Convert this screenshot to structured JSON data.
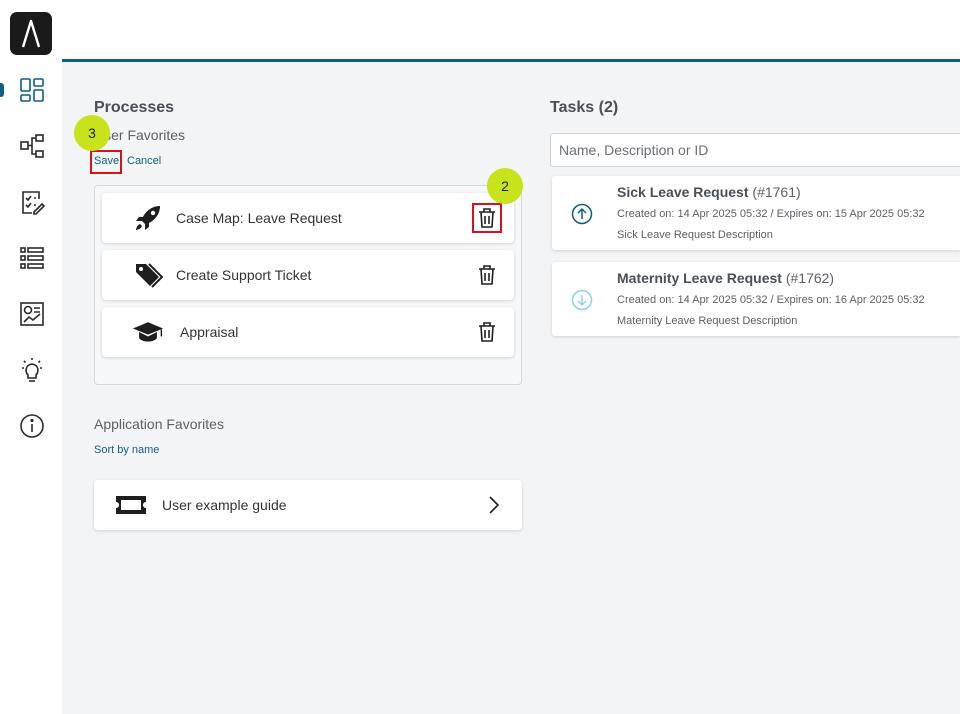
{
  "sidebar": {
    "items": [
      {
        "icon": "dashboard-icon",
        "active": true
      },
      {
        "icon": "process-map-icon"
      },
      {
        "icon": "task-checklist-icon"
      },
      {
        "icon": "list-icon"
      },
      {
        "icon": "report-chart-icon"
      },
      {
        "icon": "lightbulb-icon"
      },
      {
        "icon": "info-icon"
      }
    ]
  },
  "processes": {
    "title": "Processes",
    "user_favorites_label": "User Favorites",
    "save_label": "Save",
    "cancel_label": "Cancel",
    "favorites": [
      {
        "label": "Case Map: Leave Request",
        "icon": "rocket-icon"
      },
      {
        "label": "Create Support Ticket",
        "icon": "tags-icon"
      },
      {
        "label": "Appraisal",
        "icon": "graduation-cap-icon"
      }
    ],
    "application_favorites_label": "Application Favorites",
    "sort_label": "Sort by name",
    "app_favorites": [
      {
        "label": "User example guide",
        "icon": "ticket-icon"
      }
    ]
  },
  "annotations": {
    "badge_2": "2",
    "badge_3": "3"
  },
  "tasks": {
    "title": "Tasks (2)",
    "search_placeholder": "Name, Description or ID",
    "items": [
      {
        "name": "Sick Leave Request",
        "id": "(#1761)",
        "dates": "Created on: 14 Apr 2025 05:32 / Expires on: 15 Apr 2025 05:32",
        "description": "Sick Leave Request Description",
        "icon": "arrow-up-circle-icon"
      },
      {
        "name": "Maternity Leave Request",
        "id": "(#1762)",
        "dates": "Created on: 14 Apr 2025 05:32 / Expires on: 16 Apr 2025 05:32",
        "description": "Maternity Leave Request Description",
        "icon": "arrow-down-circle-icon"
      }
    ]
  },
  "colors": {
    "accent": "#0d5f86",
    "highlight": "#d6141a",
    "badge": "#c8e21c"
  }
}
